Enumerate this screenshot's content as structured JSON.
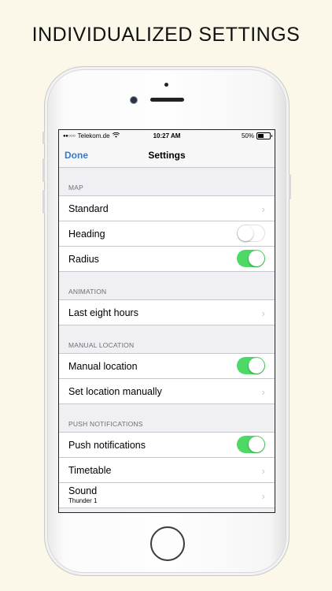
{
  "headline": "INDIVIDUALIZED SETTINGS",
  "status_bar": {
    "signal": "●●○○○",
    "carrier": "Telekom.de",
    "wifi_icon": "wifi-icon",
    "time": "10:27 AM",
    "battery_percent": "50%",
    "battery_level": 0.5
  },
  "nav": {
    "done_label": "Done",
    "title": "Settings"
  },
  "sections": {
    "map": {
      "header": "MAP",
      "standard": "Standard",
      "heading": "Heading",
      "heading_on": false,
      "radius": "Radius",
      "radius_on": true
    },
    "animation": {
      "header": "ANIMATION",
      "last_eight_hours": "Last eight hours"
    },
    "manual_location": {
      "header": "MANUAL LOCATION",
      "manual_location": "Manual location",
      "manual_location_on": true,
      "set_location_manually": "Set location manually"
    },
    "push_notifications": {
      "header": "PUSH NOTIFICATIONS",
      "push_notifications": "Push notifications",
      "push_notifications_on": true,
      "timetable": "Timetable",
      "sound": "Sound",
      "sound_value": "Thunder 1"
    }
  },
  "colors": {
    "accent": "#2f7ad6",
    "toggle_on": "#4cd964",
    "background": "#fbf8e9"
  }
}
